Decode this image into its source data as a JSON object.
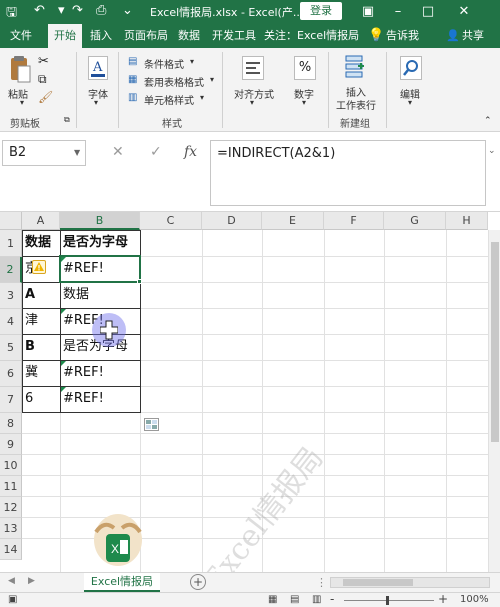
{
  "window": {
    "title": "Excel情报局.xlsx - Excel(产...",
    "login_label": "登录",
    "minimize": "–",
    "restore": "□",
    "close": "✕"
  },
  "ribbon_tabs": [
    "文件",
    "开始",
    "插入",
    "页面布局",
    "数据",
    "开发工具",
    "关注：Excel情报局",
    "告诉我",
    "共享"
  ],
  "ribbon": {
    "paste": "粘贴",
    "clipboard_group": "剪贴板",
    "font": "字体",
    "conditional_format": "条件格式",
    "table_format": "套用表格格式",
    "cell_style": "单元格样式",
    "styles_group": "样式",
    "alignment": "对齐方式",
    "number": "数字",
    "insert": "插入",
    "insert_sub": "工作表行",
    "new_group": "新建组",
    "edit": "编辑"
  },
  "formula_bar": {
    "name_box": "B2",
    "formula": "=INDIRECT(A2&1)",
    "cancel": "✕",
    "confirm": "✓",
    "fx": "fx"
  },
  "columns": [
    "A",
    "B",
    "C",
    "D",
    "E",
    "F",
    "G",
    "H"
  ],
  "rows": [
    "1",
    "2",
    "3",
    "4",
    "5",
    "6",
    "7",
    "8",
    "9",
    "10",
    "11",
    "12",
    "13",
    "14"
  ],
  "cells": {
    "a1": "数据",
    "b1": "是否为字母",
    "a2": "京",
    "b2": "#REF!",
    "a3": "A",
    "b3": "数据",
    "a4": "津",
    "b4": "#REF!",
    "a5": "B",
    "b5": "是否为字母",
    "a6": "冀",
    "b6": "#REF!",
    "a7": "6",
    "b7": "#REF!"
  },
  "sheet_tab": "Excel情报局",
  "add_sheet": "+",
  "status": {
    "zoom": "100%",
    "minus": "-",
    "plus": "+"
  },
  "watermark": "Excel情报局"
}
